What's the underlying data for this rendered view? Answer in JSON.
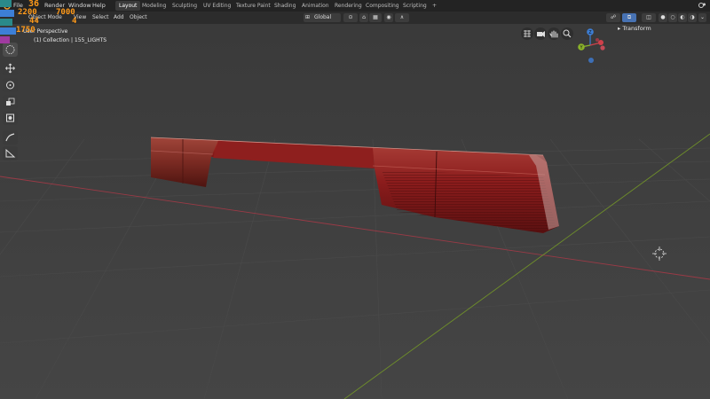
{
  "menu": {
    "items": [
      "File",
      "Render",
      "Window",
      "Help"
    ]
  },
  "workspaces": {
    "tabs": [
      "Layout",
      "Modeling",
      "Sculpting",
      "UV Editing",
      "Texture Paint",
      "Shading",
      "Animation",
      "Rendering",
      "Compositing",
      "Scripting",
      "+"
    ]
  },
  "header": {
    "mode": "Object Mode",
    "view": "View",
    "select": "Select",
    "add": "Add",
    "object": "Object",
    "orientation": "Global"
  },
  "viewport": {
    "view_name": "User Perspective",
    "collection_label": "(1) Collection | 155_LIGHTS"
  },
  "overlay_stats": {
    "top_value": "36",
    "mid_left": "2200",
    "mid_right": "7000",
    "row3_left": "44",
    "row3_right": "4",
    "bottom": "1750"
  },
  "gizmo": {
    "z_label": "Z",
    "y_label": "Y"
  },
  "sidebar": {
    "transform_label": "Transform"
  },
  "colors": {
    "accent": "#4772b3",
    "axis_x": "#d0404a",
    "axis_y": "#8ab32a",
    "axis_z": "#3d7fd6",
    "stat_green": "#3fd06b",
    "stat_orange": "#ff9a1a"
  }
}
